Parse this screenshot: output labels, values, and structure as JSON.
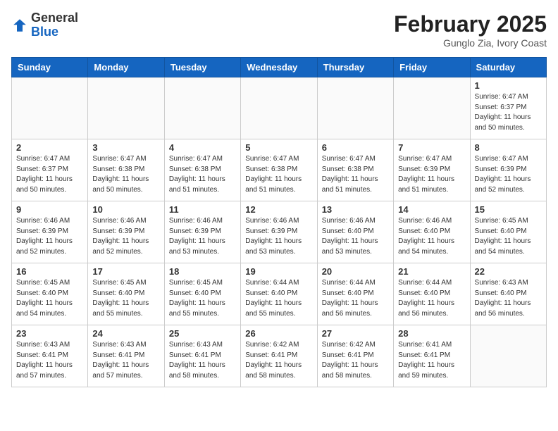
{
  "header": {
    "logo_general": "General",
    "logo_blue": "Blue",
    "month_title": "February 2025",
    "subtitle": "Gunglo Zia, Ivory Coast"
  },
  "days_of_week": [
    "Sunday",
    "Monday",
    "Tuesday",
    "Wednesday",
    "Thursday",
    "Friday",
    "Saturday"
  ],
  "weeks": [
    [
      {
        "day": "",
        "info": ""
      },
      {
        "day": "",
        "info": ""
      },
      {
        "day": "",
        "info": ""
      },
      {
        "day": "",
        "info": ""
      },
      {
        "day": "",
        "info": ""
      },
      {
        "day": "",
        "info": ""
      },
      {
        "day": "1",
        "info": "Sunrise: 6:47 AM\nSunset: 6:37 PM\nDaylight: 11 hours\nand 50 minutes."
      }
    ],
    [
      {
        "day": "2",
        "info": "Sunrise: 6:47 AM\nSunset: 6:37 PM\nDaylight: 11 hours\nand 50 minutes."
      },
      {
        "day": "3",
        "info": "Sunrise: 6:47 AM\nSunset: 6:38 PM\nDaylight: 11 hours\nand 50 minutes."
      },
      {
        "day": "4",
        "info": "Sunrise: 6:47 AM\nSunset: 6:38 PM\nDaylight: 11 hours\nand 51 minutes."
      },
      {
        "day": "5",
        "info": "Sunrise: 6:47 AM\nSunset: 6:38 PM\nDaylight: 11 hours\nand 51 minutes."
      },
      {
        "day": "6",
        "info": "Sunrise: 6:47 AM\nSunset: 6:38 PM\nDaylight: 11 hours\nand 51 minutes."
      },
      {
        "day": "7",
        "info": "Sunrise: 6:47 AM\nSunset: 6:39 PM\nDaylight: 11 hours\nand 51 minutes."
      },
      {
        "day": "8",
        "info": "Sunrise: 6:47 AM\nSunset: 6:39 PM\nDaylight: 11 hours\nand 52 minutes."
      }
    ],
    [
      {
        "day": "9",
        "info": "Sunrise: 6:46 AM\nSunset: 6:39 PM\nDaylight: 11 hours\nand 52 minutes."
      },
      {
        "day": "10",
        "info": "Sunrise: 6:46 AM\nSunset: 6:39 PM\nDaylight: 11 hours\nand 52 minutes."
      },
      {
        "day": "11",
        "info": "Sunrise: 6:46 AM\nSunset: 6:39 PM\nDaylight: 11 hours\nand 53 minutes."
      },
      {
        "day": "12",
        "info": "Sunrise: 6:46 AM\nSunset: 6:39 PM\nDaylight: 11 hours\nand 53 minutes."
      },
      {
        "day": "13",
        "info": "Sunrise: 6:46 AM\nSunset: 6:40 PM\nDaylight: 11 hours\nand 53 minutes."
      },
      {
        "day": "14",
        "info": "Sunrise: 6:46 AM\nSunset: 6:40 PM\nDaylight: 11 hours\nand 54 minutes."
      },
      {
        "day": "15",
        "info": "Sunrise: 6:45 AM\nSunset: 6:40 PM\nDaylight: 11 hours\nand 54 minutes."
      }
    ],
    [
      {
        "day": "16",
        "info": "Sunrise: 6:45 AM\nSunset: 6:40 PM\nDaylight: 11 hours\nand 54 minutes."
      },
      {
        "day": "17",
        "info": "Sunrise: 6:45 AM\nSunset: 6:40 PM\nDaylight: 11 hours\nand 55 minutes."
      },
      {
        "day": "18",
        "info": "Sunrise: 6:45 AM\nSunset: 6:40 PM\nDaylight: 11 hours\nand 55 minutes."
      },
      {
        "day": "19",
        "info": "Sunrise: 6:44 AM\nSunset: 6:40 PM\nDaylight: 11 hours\nand 55 minutes."
      },
      {
        "day": "20",
        "info": "Sunrise: 6:44 AM\nSunset: 6:40 PM\nDaylight: 11 hours\nand 56 minutes."
      },
      {
        "day": "21",
        "info": "Sunrise: 6:44 AM\nSunset: 6:40 PM\nDaylight: 11 hours\nand 56 minutes."
      },
      {
        "day": "22",
        "info": "Sunrise: 6:43 AM\nSunset: 6:40 PM\nDaylight: 11 hours\nand 56 minutes."
      }
    ],
    [
      {
        "day": "23",
        "info": "Sunrise: 6:43 AM\nSunset: 6:41 PM\nDaylight: 11 hours\nand 57 minutes."
      },
      {
        "day": "24",
        "info": "Sunrise: 6:43 AM\nSunset: 6:41 PM\nDaylight: 11 hours\nand 57 minutes."
      },
      {
        "day": "25",
        "info": "Sunrise: 6:43 AM\nSunset: 6:41 PM\nDaylight: 11 hours\nand 58 minutes."
      },
      {
        "day": "26",
        "info": "Sunrise: 6:42 AM\nSunset: 6:41 PM\nDaylight: 11 hours\nand 58 minutes."
      },
      {
        "day": "27",
        "info": "Sunrise: 6:42 AM\nSunset: 6:41 PM\nDaylight: 11 hours\nand 58 minutes."
      },
      {
        "day": "28",
        "info": "Sunrise: 6:41 AM\nSunset: 6:41 PM\nDaylight: 11 hours\nand 59 minutes."
      },
      {
        "day": "",
        "info": ""
      }
    ]
  ]
}
